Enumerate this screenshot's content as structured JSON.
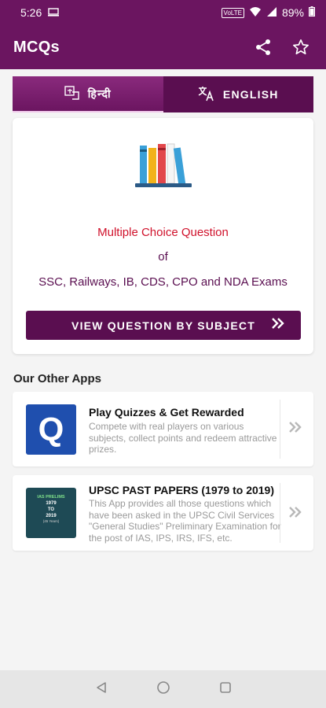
{
  "status": {
    "time": "5:26",
    "volte": "VoLTE",
    "battery": "89%"
  },
  "appbar": {
    "title": "MCQs",
    "share_icon": "share-icon",
    "favorite_icon": "star-icon"
  },
  "tabs": [
    {
      "label": "हिन्दी",
      "icon": "translate-hindi-icon"
    },
    {
      "label": "ENGLISH",
      "icon": "translate-icon"
    }
  ],
  "hero": {
    "line1": "Multiple Choice Question",
    "line2": "of",
    "line3": "SSC, Railways, IB, CDS, CPO and NDA Exams",
    "button_label": "VIEW QUESTION BY SUBJECT",
    "book_colors": [
      "#3aa0d8",
      "#f2b21a",
      "#e2474b",
      "#f5f5f5",
      "#3aa0d8"
    ]
  },
  "other_apps": {
    "title": "Our Other Apps",
    "items": [
      {
        "title": "Play Quizzes & Get Rewarded",
        "description": "Compete with real players on various subjects, collect points and redeem attractive prizes.",
        "icon_letter": "Q",
        "icon_color": "#1f4fae"
      },
      {
        "title": "UPSC PAST PAPERS (1979 to 2019)",
        "description": "This App provides all those questions which have been asked in the UPSC Civil Services \"General Studies\" Preliminary Examination for the post of IAS, IPS, IRS, IFS, etc.",
        "thumb_lines": [
          "IAS PRELIMS",
          "1979",
          "TO",
          "2019",
          "(45 Years)"
        ],
        "icon_color": "#1e4a55"
      }
    ]
  },
  "colors": {
    "primary": "#6b1560",
    "accent_red": "#d0112b"
  }
}
